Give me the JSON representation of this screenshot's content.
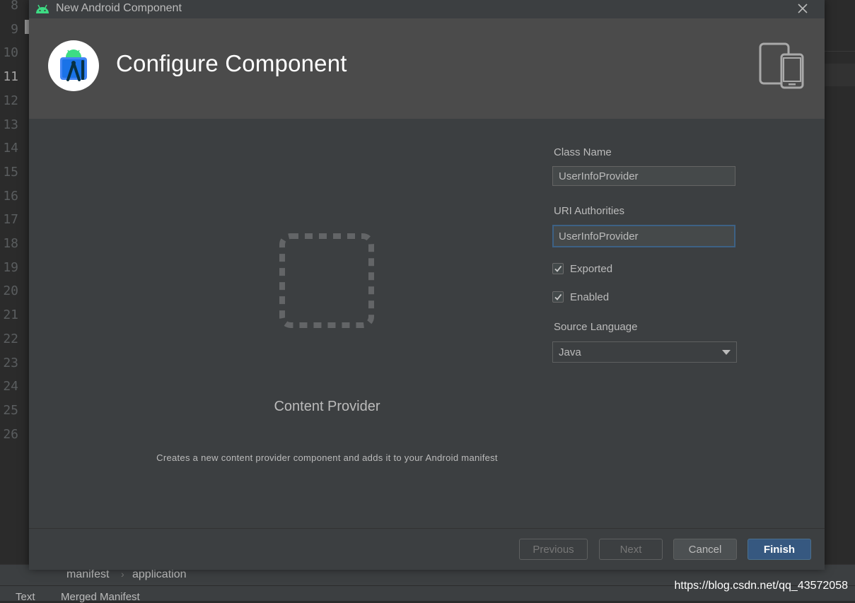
{
  "editor": {
    "line_numbers": [
      "8",
      "9",
      "10",
      "11",
      "12",
      "13",
      "14",
      "15",
      "16",
      "17",
      "18",
      "19",
      "20",
      "21",
      "22",
      "23",
      "24",
      "25",
      "26"
    ],
    "breadcrumb": [
      "manifest",
      "application"
    ],
    "bottom_tabs": [
      "Text",
      "Merged Manifest"
    ]
  },
  "watermark": "https://blog.csdn.net/qq_43572058",
  "dialog": {
    "window_title": "New Android Component",
    "header_title": "Configure Component",
    "component_name": "Content Provider",
    "component_description": "Creates a new content provider component and adds it to your Android manifest",
    "form": {
      "class_name_label": "Class Name",
      "class_name_value": "UserInfoProvider",
      "uri_label": "URI Authorities",
      "uri_value": "UserInfoProvider",
      "exported_label": "Exported",
      "exported_checked": true,
      "enabled_label": "Enabled",
      "enabled_checked": true,
      "source_language_label": "Source Language",
      "source_language_value": "Java"
    },
    "buttons": {
      "previous": "Previous",
      "next": "Next",
      "cancel": "Cancel",
      "finish": "Finish"
    }
  },
  "colors": {
    "accent": "#365880",
    "focus": "#3d6185",
    "android_green": "#3ddc84",
    "header_bg": "#4b4b4b",
    "dialog_bg": "#3c3f41"
  },
  "icons": {
    "title": "android-head-icon",
    "logo": "android-studio-logo-icon",
    "device": "phone-tablet-icon",
    "close": "close-icon",
    "placeholder": "component-placeholder-icon",
    "checkbox": "check-icon",
    "dropdown": "chevron-down-icon"
  }
}
